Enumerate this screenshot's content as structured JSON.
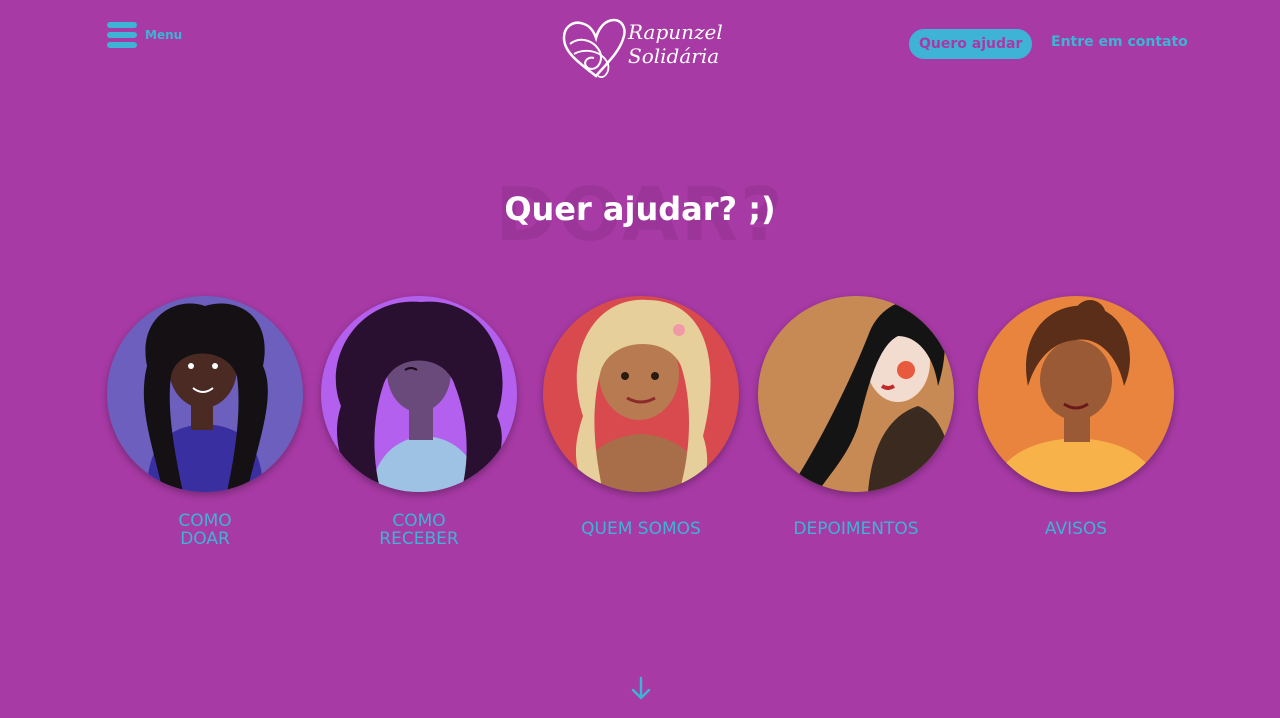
{
  "header": {
    "menu_label": "Menu",
    "logo_line1": "Rapunzel",
    "logo_line2": "Solidária",
    "cta_label": "Quero ajudar",
    "contact_label": "Entre em contato"
  },
  "hero": {
    "background_word": "DOAR?",
    "title": "Quer ajudar? ;)"
  },
  "cards": [
    {
      "line1": "Como",
      "line2": "Doar",
      "bg": "#6c5fbd",
      "icon": "woman-illustration-icon"
    },
    {
      "line1": "Como",
      "line2": "Receber",
      "bg": "#b360ee",
      "icon": "woman-illustration-icon"
    },
    {
      "line1": "Quem Somos",
      "bg": "#d84a4e",
      "icon": "woman-illustration-icon"
    },
    {
      "line1": "Depoimentos",
      "bg": "#c88a55",
      "icon": "woman-illustration-icon"
    },
    {
      "line1": "Avisos",
      "bg": "#e8843e",
      "icon": "woman-illustration-icon"
    }
  ],
  "colors": {
    "background": "#a83aa6",
    "accent": "#3fb3d6",
    "text_light": "#ffffff"
  },
  "icons": {
    "menu": "hamburger-menu-icon",
    "logo": "heart-logo-icon",
    "scroll": "arrow-down-icon"
  }
}
